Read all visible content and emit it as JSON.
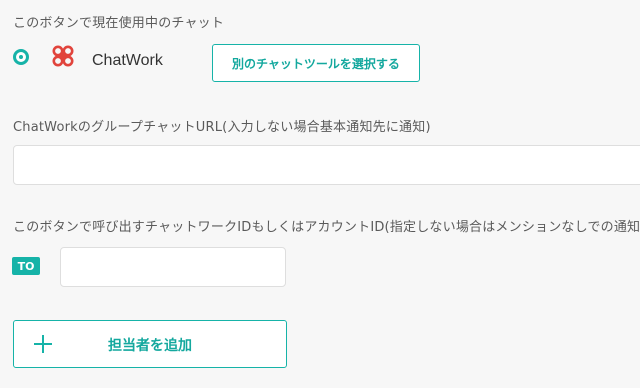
{
  "current_chat": {
    "label": "このボタンで現在使用中のチャット",
    "service_name": "ChatWork",
    "logo_icon": "chatwork-logo-icon",
    "select_button_label": "別のチャットツールを選択する"
  },
  "group_url": {
    "label": "ChatWorkのグループチャットURL(入力しない場合基本通知先に通知)",
    "value": "",
    "placeholder": ""
  },
  "to_account": {
    "label": "このボタンで呼び出すチャットワークIDもしくはアカウントID(指定しない場合はメンションなしでの通知)",
    "badge": "TO",
    "value": "",
    "placeholder": ""
  },
  "add_assignee": {
    "label": "担当者を追加",
    "icon": "plus-icon"
  },
  "colors": {
    "accent": "#16b3a8",
    "background": "#f7f7f7",
    "logo_red": "#e1443c"
  }
}
